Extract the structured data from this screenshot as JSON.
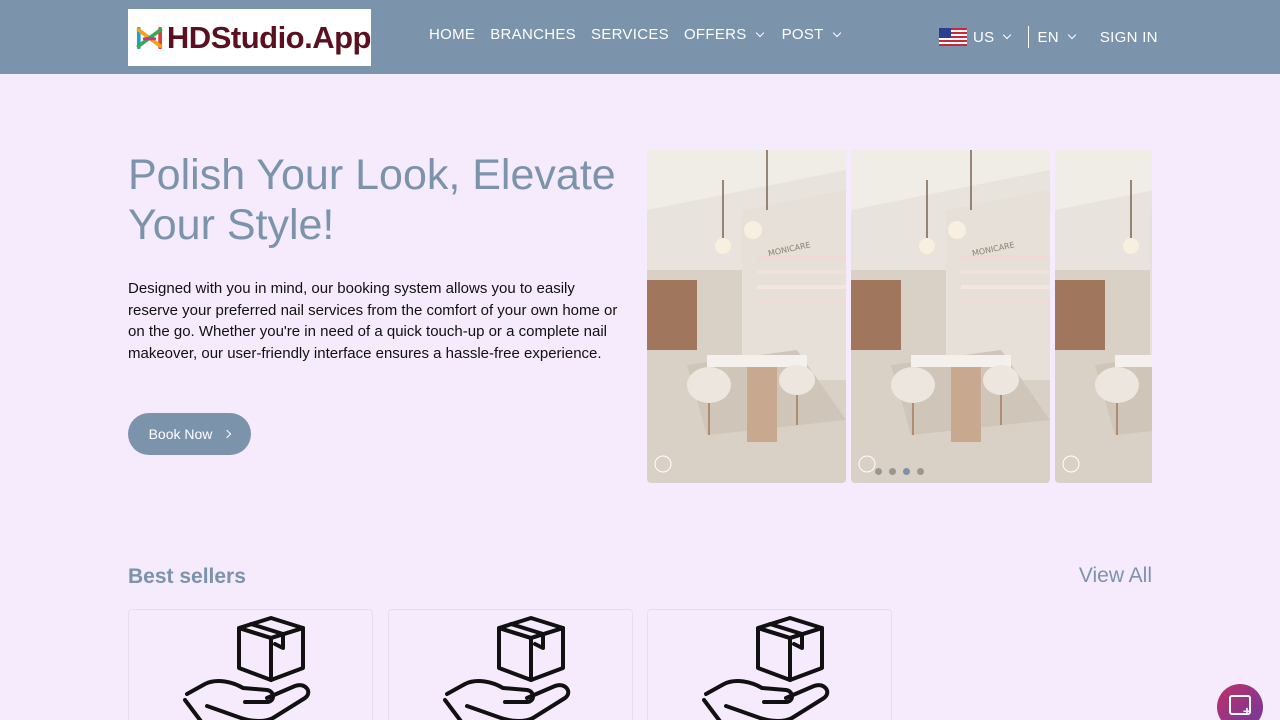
{
  "header": {
    "brand": "HDStudio.App",
    "nav": [
      {
        "label": "HOME",
        "has_dropdown": false
      },
      {
        "label": "BRANCHES",
        "has_dropdown": false
      },
      {
        "label": "SERVICES",
        "has_dropdown": false
      },
      {
        "label": "OFFERS",
        "has_dropdown": true
      },
      {
        "label": "POST",
        "has_dropdown": true
      }
    ],
    "country": "US",
    "language": "EN",
    "signin": "SIGN IN"
  },
  "hero": {
    "title": "Polish Your Look, Elevate Your Style!",
    "description": "Designed with you in mind, our booking system allows you to easily reserve your preferred nail services from the comfort of your own home or on the go. Whether you're in need of a quick touch-up or a complete nail makeover, our user-friendly interface ensures a hassle-free experience.",
    "cta": "Book Now"
  },
  "carousel": {
    "slide_wall_text": "MONICARE",
    "slide_count_visible": 3,
    "dots": 4,
    "active_dot": 3
  },
  "best_sellers": {
    "title": "Best sellers",
    "view_all": "View All",
    "card_icon": "hand-holding-box-icon",
    "card_count": 3
  },
  "colors": {
    "header_bg": "#7b93ab",
    "page_bg": "#f5ebfc",
    "accent": "#7b93ab",
    "brand_text": "#5a1020"
  }
}
